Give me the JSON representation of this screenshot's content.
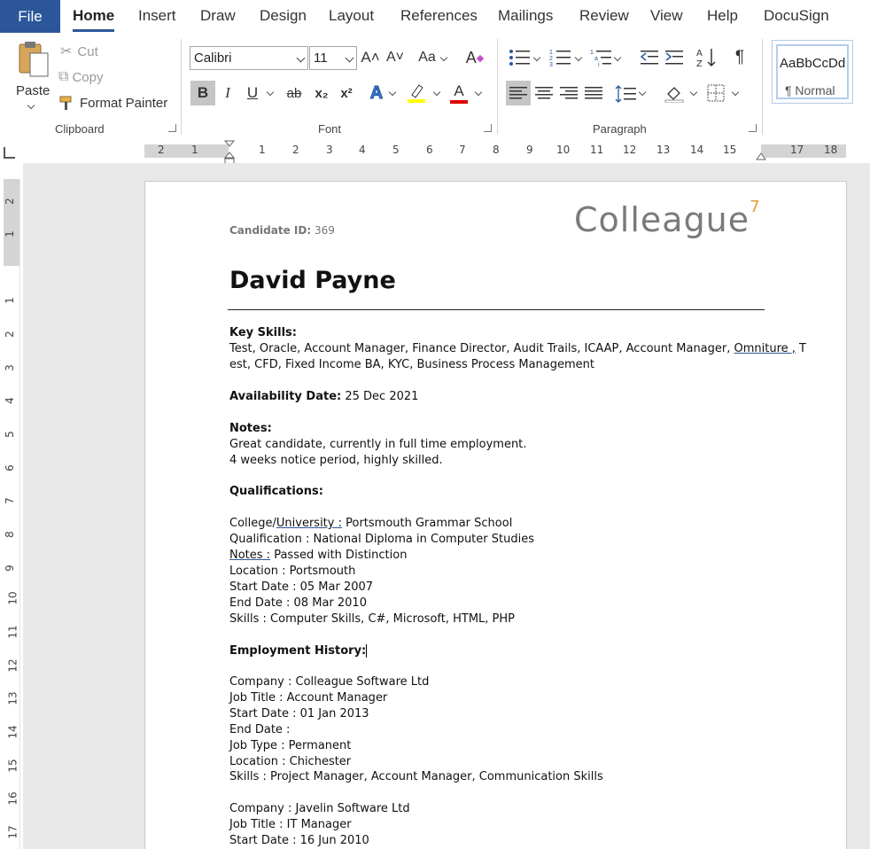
{
  "tabs": {
    "file": "File",
    "home": "Home",
    "insert": "Insert",
    "draw": "Draw",
    "design": "Design",
    "layout": "Layout",
    "references": "References",
    "mailings": "Mailings",
    "review": "Review",
    "view": "View",
    "help": "Help",
    "docusign": "DocuSign"
  },
  "ribbon": {
    "clipboard": {
      "label": "Clipboard",
      "paste": "Paste",
      "cut": "Cut",
      "copy": "Copy",
      "format_painter": "Format Painter"
    },
    "font": {
      "label": "Font",
      "font_name": "Calibri",
      "font_size": "11",
      "grow": "A˄",
      "shrink": "A˅",
      "change_case": "Aa",
      "bold": "B",
      "italic": "I",
      "underline": "U",
      "strikethrough": "ab",
      "subscript": "x₂",
      "superscript": "x²",
      "text_effects": "A",
      "font_color": "A",
      "highlight_color": "#ffff00",
      "font_color_value": "#e00000"
    },
    "paragraph": {
      "label": "Paragraph",
      "pilcrow": "¶"
    },
    "styles": {
      "sample": "AaBbCcDd",
      "name": "¶ Normal"
    }
  },
  "ruler": {
    "h_left": [
      "2",
      "1"
    ],
    "h_right": [
      "1",
      "2",
      "3",
      "4",
      "5",
      "6",
      "7",
      "8",
      "9",
      "10",
      "11",
      "12",
      "13",
      "14",
      "15"
    ],
    "h_far": [
      "17",
      "18"
    ],
    "v_top": [
      "2",
      "1"
    ],
    "v_body": [
      "1",
      "2",
      "3",
      "4",
      "5",
      "6",
      "7",
      "8",
      "9",
      "10",
      "11",
      "12",
      "13",
      "14",
      "15",
      "16",
      "17"
    ]
  },
  "document": {
    "logo_text": "Colleague",
    "logo_mark": "7",
    "candidate_label": "Candidate ID:",
    "candidate_value": " 369",
    "name": "David Payne",
    "key_skills_heading": "Key Skills:",
    "key_skills_line1_a": "Test, Oracle, Account Manager, Finance Director, Audit Trails, ICAAP, Account Manager, ",
    "key_skills_line1_u": "Omniture ,",
    "key_skills_line1_b": " T",
    "key_skills_line2": "est, CFD, Fixed Income BA, KYC, Business Process Management",
    "availability_label": "Availability Date:",
    "availability_value": " 25 Dec 2021",
    "notes_heading": "Notes:",
    "notes_line1": "Great candidate, currently in full time employment.",
    "notes_line2": "4 weeks notice period, highly skilled.",
    "qualifications_heading": "Qualifications:",
    "qual_college_a": "College/",
    "qual_college_u": "University :",
    "qual_college_b": " Portsmouth Grammar School",
    "qual_qualification": "Qualification : National Diploma in Computer Studies",
    "qual_notes_u": "Notes :",
    "qual_notes_b": " Passed with Distinction",
    "qual_location": "Location : Portsmouth",
    "qual_start": "Start Date : 05 Mar 2007",
    "qual_end": "End Date : 08 Mar 2010",
    "qual_skills": "Skills : Computer Skills, C#, Microsoft, HTML, PHP",
    "employment_heading": "Employment History:",
    "emp1_company": "Company : Colleague Software Ltd",
    "emp1_title": "Job Title : Account Manager",
    "emp1_start": "Start Date : 01 Jan 2013",
    "emp1_end": "End Date :",
    "emp1_type": "Job Type : Permanent",
    "emp1_location": "Location : Chichester",
    "emp1_skills": "Skills : Project Manager, Account Manager, Communication Skills",
    "emp2_company": "Company : Javelin Software Ltd",
    "emp2_title": "Job Title : IT Manager",
    "emp2_start": "Start Date : 16 Jun 2010"
  }
}
